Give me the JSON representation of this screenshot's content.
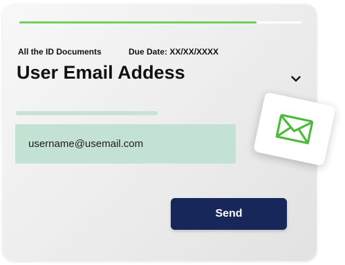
{
  "progress": {
    "fraction": 0.84,
    "fill_color": "#6fd15a",
    "track_color": "#ffffff"
  },
  "meta": {
    "documents_label": "All the ID Documents",
    "due_date_label": "Due Date: XX/XX/XXXX"
  },
  "field": {
    "title": "User Email Addess",
    "value": "username@usemail.com",
    "dropdown_icon": "chevron-down-icon"
  },
  "actions": {
    "send_label": "Send",
    "send_color": "#17275a"
  },
  "decoration": {
    "icon": "envelope-icon",
    "icon_color": "#4cbb3a"
  }
}
